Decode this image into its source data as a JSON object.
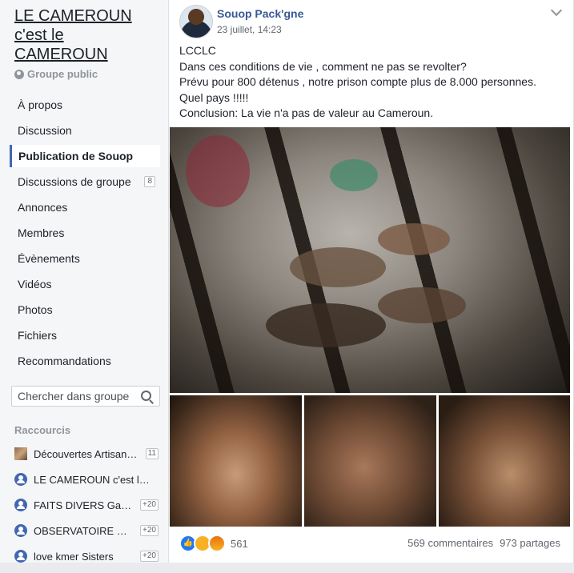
{
  "sidebar": {
    "group_title": "LE CAMEROUN c'est le CAMEROUN",
    "group_type": "Groupe public",
    "nav": [
      {
        "label": "À propos"
      },
      {
        "label": "Discussion"
      },
      {
        "label": "Publication de Souop",
        "active": true
      },
      {
        "label": "Discussions de groupe",
        "badge": "8"
      },
      {
        "label": "Annonces"
      },
      {
        "label": "Membres"
      },
      {
        "label": "Évènements"
      },
      {
        "label": "Vidéos"
      },
      {
        "label": "Photos"
      },
      {
        "label": "Fichiers"
      },
      {
        "label": "Recommandations"
      }
    ],
    "search_placeholder": "Chercher dans groupe",
    "shortcuts_title": "Raccourcis",
    "shortcuts": [
      {
        "label": "Découvertes Artisan…",
        "count": "11",
        "icon": "thumbnail"
      },
      {
        "label": "LE CAMEROUN c'est l…",
        "count": "",
        "icon": "group-icon"
      },
      {
        "label": "FAITS DIVERS Ga…",
        "count": "+20",
        "icon": "group-icon"
      },
      {
        "label": "OBSERVATOIRE …",
        "count": "+20",
        "icon": "group-icon"
      },
      {
        "label": "love kmer Sisters",
        "count": "+20",
        "icon": "group-icon"
      }
    ]
  },
  "post": {
    "author": "Souop Pack'gne",
    "timestamp": "23 juillet, 14:23",
    "text_lines": [
      "LCCLC",
      "Dans ces conditions de vie , comment ne pas se revolter?",
      "Prévu pour 800 détenus , notre prison compte plus de 8.000 personnes.",
      "Quel pays !!!!!",
      "Conclusion: La vie n'a pas de valeur au Cameroun."
    ],
    "reaction_count": "561",
    "comments": "569 commentaires",
    "shares": "973 partages",
    "reaction_icons": [
      "like-icon",
      "sad-icon",
      "angry-icon"
    ]
  },
  "colors": {
    "accent": "#4267b2",
    "link": "#385898",
    "sidebar_bg": "#f5f6f7"
  }
}
